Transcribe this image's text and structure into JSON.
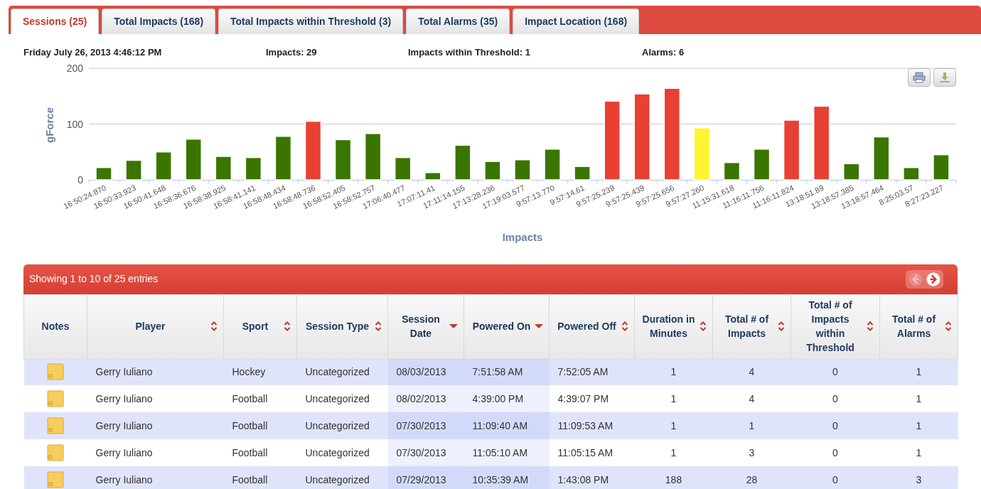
{
  "tabs": [
    {
      "label": "Sessions (25)",
      "selected": true
    },
    {
      "label": "Total Impacts (168)",
      "selected": false
    },
    {
      "label": "Total Impacts within Threshold (3)",
      "selected": false
    },
    {
      "label": "Total Alarms (35)",
      "selected": false
    },
    {
      "label": "Impact Location (168)",
      "selected": false
    }
  ],
  "summary": [
    "Friday July 26, 2013 4:46:12 PM",
    "Impacts: 29",
    "Impacts within Threshold: 1",
    "Alarms: 6"
  ],
  "chart": {
    "chart_data": {
      "type": "bar",
      "xlabel": "Impacts",
      "ylabel": "gForce",
      "stacked": true,
      "ylim": [
        0,
        200
      ],
      "yticks": [
        0,
        100,
        200
      ],
      "categories": [
        "16:50:24.870",
        "16:50:33.923",
        "16:50:41.648",
        "16:58:36.676",
        "16:58:38.925",
        "16:58:41.141",
        "16:58:48.434",
        "16:58:48.736",
        "16:58:52.405",
        "16:58:52.757",
        "17:06:40.477",
        "17:07:11.41",
        "17:11:14.155",
        "17:13:28.236",
        "17:19:03.577",
        "9:57:13.770",
        "9:57:14.61",
        "9:57:25.239",
        "9:57:25.439",
        "9:57:25.656",
        "9:57:27.260",
        "11:15:31.618",
        "11:16:11.756",
        "11:16:11.824",
        "13:18:51.89",
        "13:18:57.385",
        "13:18:57.464",
        "8:25:03.57",
        "8:27:23.227"
      ],
      "series": [
        {
          "color": "#3a7500",
          "values": [
            22,
            35,
            50,
            73,
            42,
            40,
            78,
            null,
            72,
            83,
            40,
            13,
            62,
            33,
            36,
            55,
            24,
            null,
            null,
            null,
            null,
            31,
            55,
            null,
            null,
            29,
            77,
            22,
            45
          ]
        },
        {
          "color": "#e84033",
          "values": [
            null,
            null,
            null,
            null,
            null,
            null,
            null,
            105,
            null,
            null,
            null,
            null,
            null,
            null,
            null,
            null,
            null,
            141,
            154,
            164,
            null,
            null,
            null,
            107,
            132,
            null,
            null,
            null,
            null
          ]
        },
        {
          "color": "#fff42e",
          "values": [
            null,
            null,
            null,
            null,
            null,
            null,
            null,
            null,
            null,
            null,
            null,
            null,
            null,
            null,
            null,
            null,
            null,
            null,
            null,
            null,
            93,
            null,
            null,
            null,
            null,
            null,
            null,
            null,
            null
          ]
        }
      ]
    }
  },
  "table": {
    "info": "Showing 1 to 10 of 25 entries",
    "pager": {
      "previous_disabled": true,
      "next_disabled": false
    },
    "columns": [
      {
        "label": "Notes",
        "sortable": false
      },
      {
        "label": "Player",
        "sortable": true,
        "sorted_desc": false
      },
      {
        "label": "Sport",
        "sortable": true,
        "sorted_desc": false
      },
      {
        "label": "Session Type",
        "sortable": true,
        "sorted_desc": false
      },
      {
        "label": "Session Date",
        "sortable": true,
        "sorted_desc": true
      },
      {
        "label": "Powered On",
        "sortable": true,
        "sorted_desc": true
      },
      {
        "label": "Powered Off",
        "sortable": true,
        "sorted_desc": false
      },
      {
        "label": "Duration in Minutes",
        "sortable": true,
        "sorted_desc": false
      },
      {
        "label": "Total # of Impacts",
        "sortable": true,
        "sorted_desc": false
      },
      {
        "label": "Total # of Impacts within Threshold",
        "sortable": true,
        "sorted_desc": false
      },
      {
        "label": "Total # of Alarms",
        "sortable": true,
        "sorted_desc": false
      }
    ],
    "rows": [
      {
        "cells": [
          "",
          "Gerry Iuliano",
          "Hockey",
          "Uncategorized",
          "08/03/2013",
          "7:51:58 AM",
          "7:52:05 AM",
          "1",
          "4",
          "0",
          "1"
        ]
      },
      {
        "cells": [
          "",
          "Gerry Iuliano",
          "Football",
          "Uncategorized",
          "08/02/2013",
          "4:39:00 PM",
          "4:39:07 PM",
          "1",
          "4",
          "0",
          "1"
        ]
      },
      {
        "cells": [
          "",
          "Gerry Iuliano",
          "Football",
          "Uncategorized",
          "07/30/2013",
          "11:09:40 AM",
          "11:09:53 AM",
          "1",
          "1",
          "0",
          "1"
        ]
      },
      {
        "cells": [
          "",
          "Gerry Iuliano",
          "Football",
          "Uncategorized",
          "07/30/2013",
          "11:05:10 AM",
          "11:05:15 AM",
          "1",
          "3",
          "0",
          "1"
        ]
      },
      {
        "cells": [
          "",
          "Gerry Iuliano",
          "Football",
          "Uncategorized",
          "07/29/2013",
          "10:35:39 AM",
          "1:43:08 PM",
          "188",
          "28",
          "0",
          "3"
        ]
      }
    ]
  }
}
